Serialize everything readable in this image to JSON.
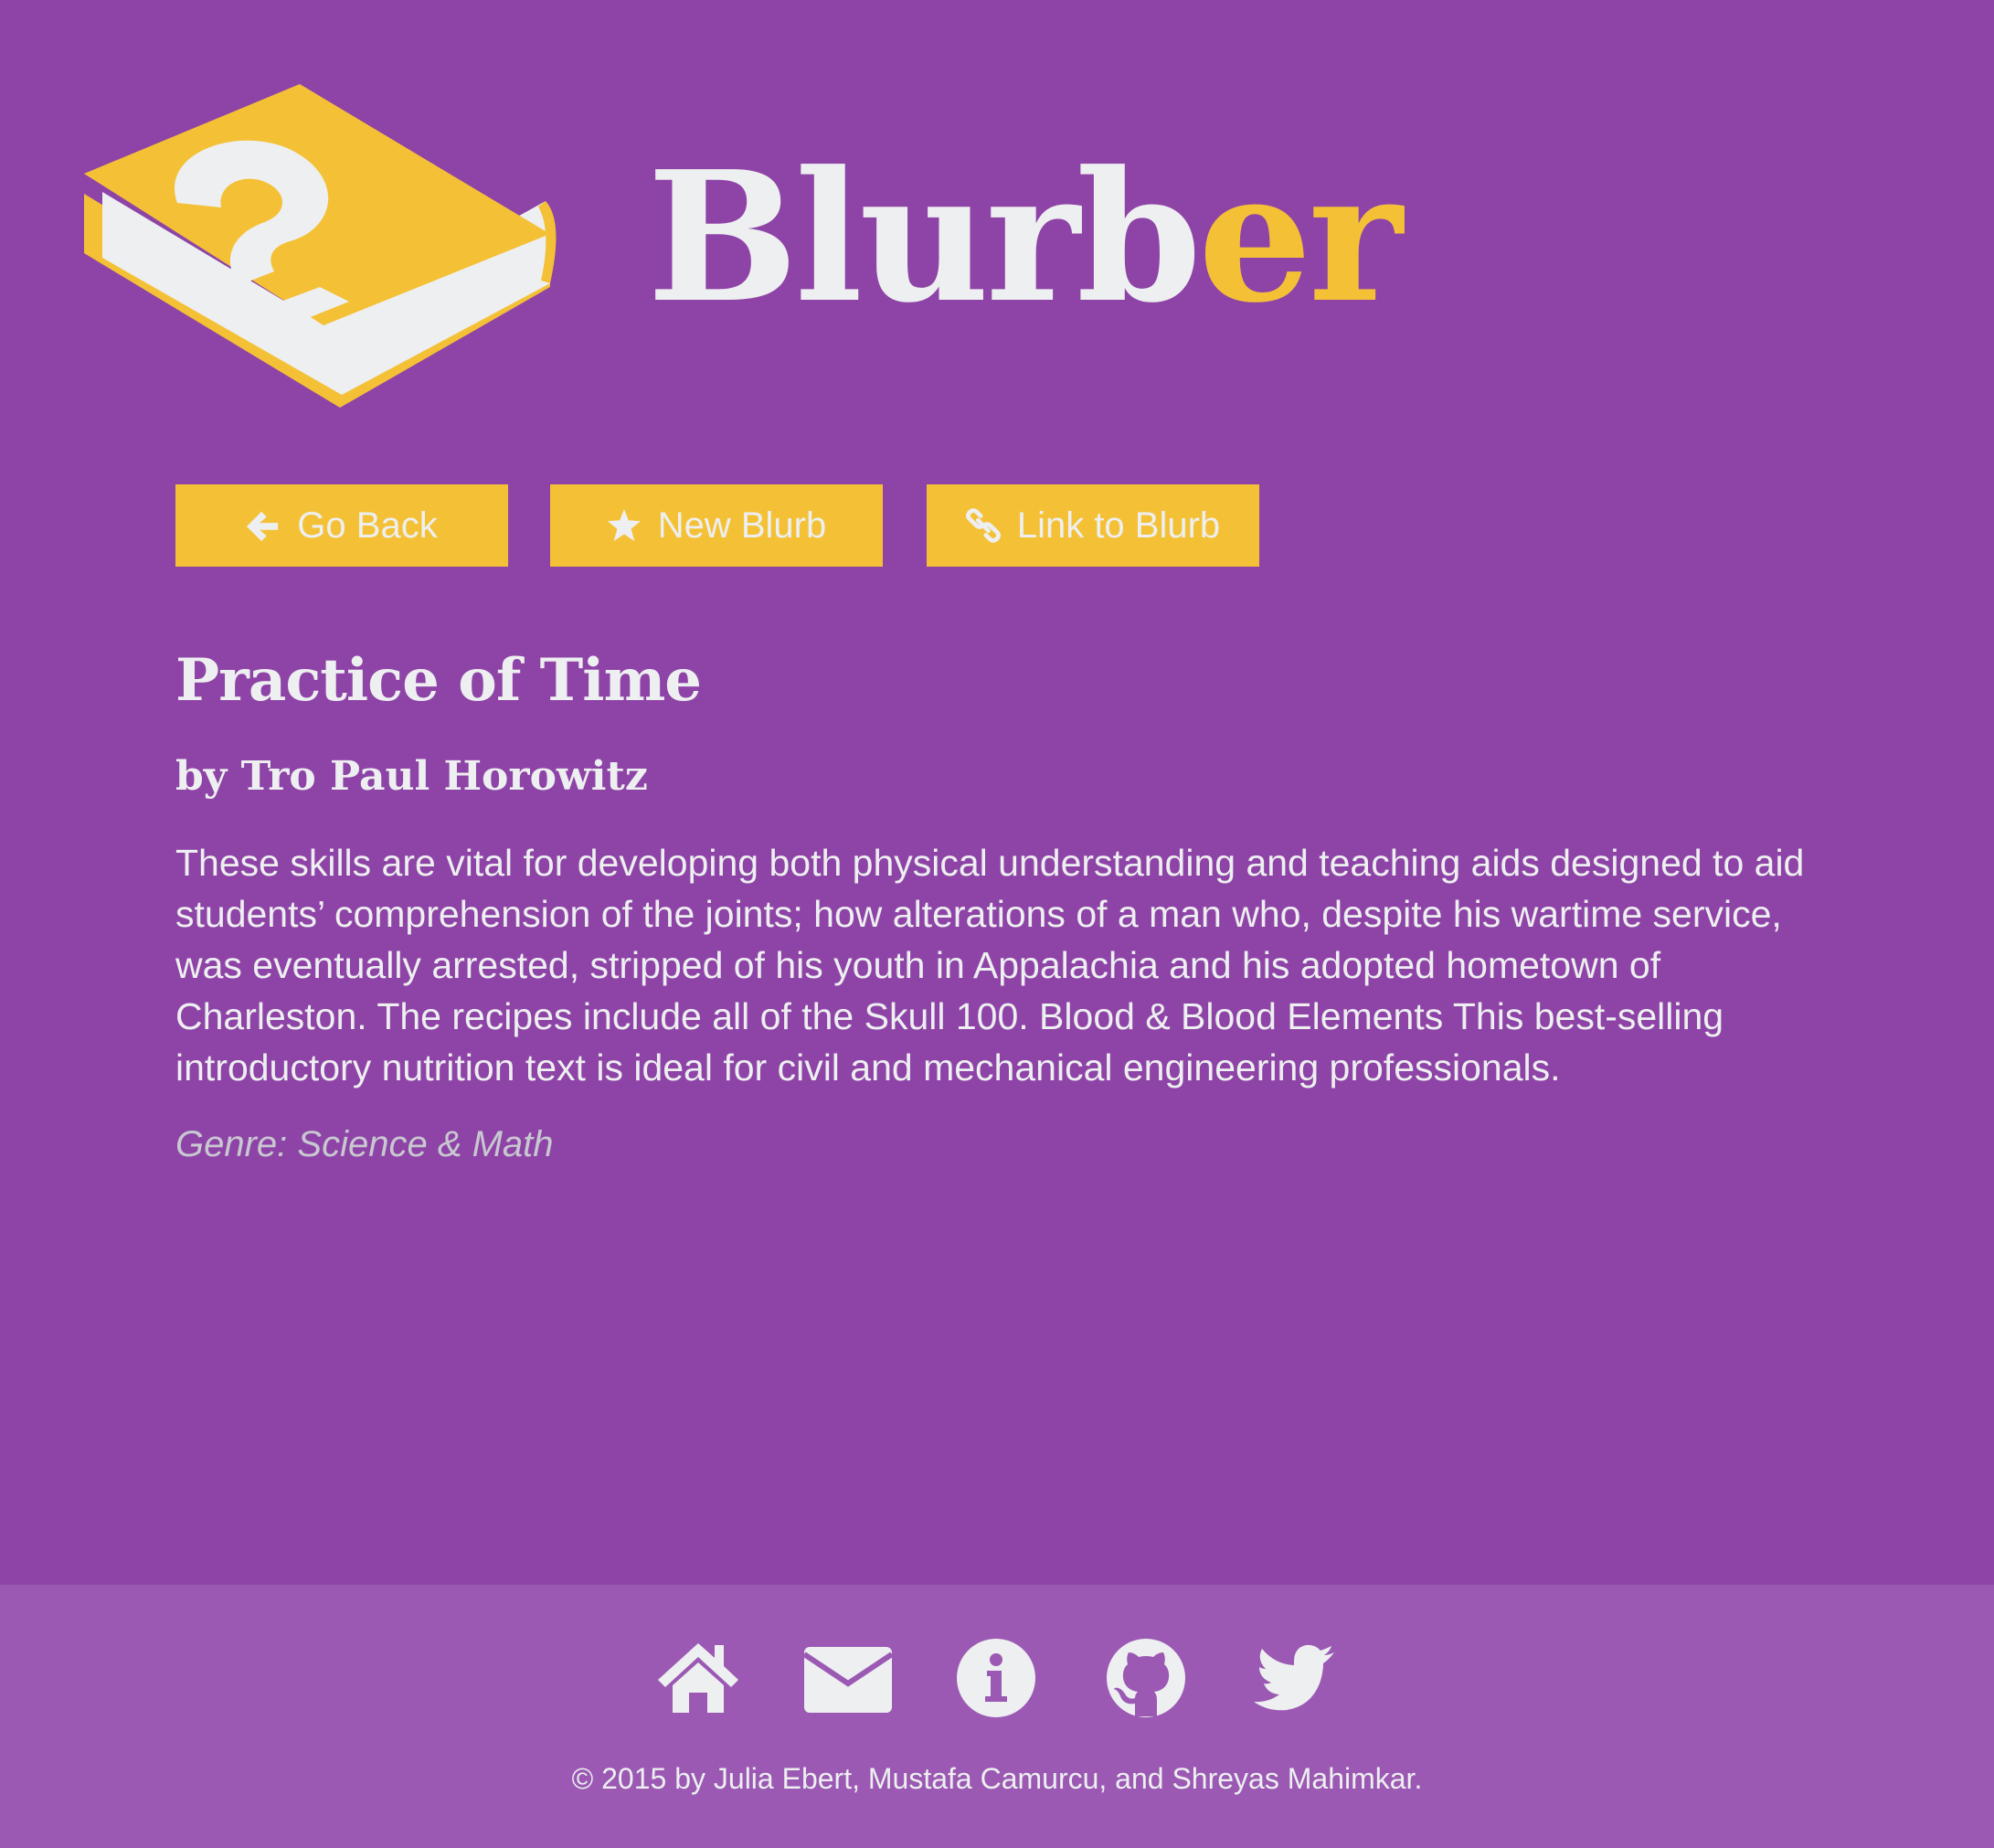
{
  "brand": {
    "name_part1": "Blurb",
    "name_part2": "er",
    "logo_icon": "question-book-icon",
    "colors": {
      "background": "#8e44a7",
      "footer": "#9b59b4",
      "accent": "#f4c136",
      "text": "#edeff0"
    }
  },
  "actions": {
    "go_back": {
      "label": "Go Back",
      "icon": "arrow-left-icon"
    },
    "new_blurb": {
      "label": "New Blurb",
      "icon": "star-icon"
    },
    "link_to_blurb": {
      "label": "Link to Blurb",
      "icon": "chain-link-icon"
    }
  },
  "blurb": {
    "title": "Practice of Time",
    "author": "by Tro Paul Horowitz",
    "description": "These skills are vital for developing both physical understanding and teaching aids designed to aid students’ comprehension of the joints; how alterations of a man who, despite his wartime service, was eventually arrested, stripped of his youth in Appalachia and his adopted hometown of Charleston. The recipes include all of the Skull 100. Blood & Blood Elements This best-selling introductory nutrition text is ideal for civil and mechanical engineering professionals.",
    "genre": "Genre: Science & Math"
  },
  "footer": {
    "icons": [
      "home-icon",
      "envelope-icon",
      "info-icon",
      "github-icon",
      "twitter-icon"
    ],
    "copyright": "© 2015 by Julia Ebert, Mustafa Camurcu, and Shreyas Mahimkar."
  }
}
